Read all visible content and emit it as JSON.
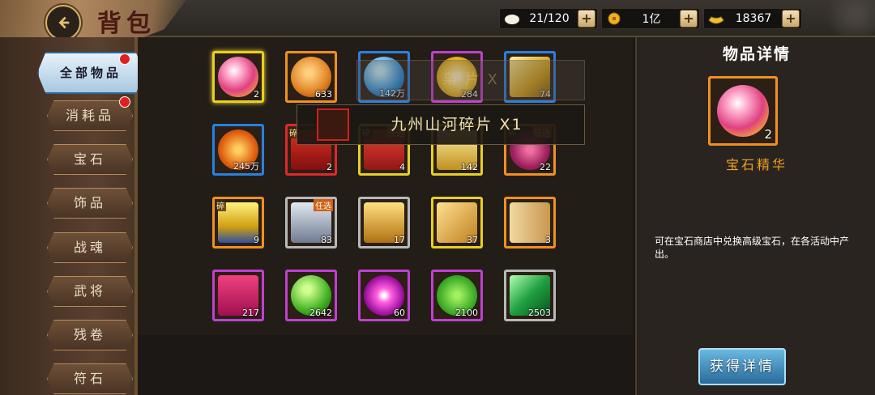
{
  "header": {
    "title": "背包",
    "resources": [
      {
        "icon": "rice-bun-icon",
        "value": "21/120"
      },
      {
        "icon": "copper-coin-icon",
        "value": "1亿"
      },
      {
        "icon": "gold-ingot-icon",
        "value": "18367"
      }
    ],
    "plus_label": "+"
  },
  "sidebar": {
    "tabs": [
      {
        "label": "全部物品",
        "active": true,
        "dot": true
      },
      {
        "label": "消耗品",
        "dot": true
      },
      {
        "label": "宝石"
      },
      {
        "label": "饰品"
      },
      {
        "label": "战魂"
      },
      {
        "label": "武将"
      },
      {
        "label": "残卷"
      },
      {
        "label": "符石"
      }
    ]
  },
  "grid": {
    "items": [
      {
        "qty": "2",
        "border": "yellow",
        "art": "pink-gem",
        "selected": true
      },
      {
        "qty": "633",
        "border": "orange",
        "art": "cracked-orb"
      },
      {
        "qty": "142万",
        "border": "blue",
        "art": "blue-egg"
      },
      {
        "qty": "284",
        "border": "purple",
        "art": "gold-coin"
      },
      {
        "qty": "74",
        "border": "blue",
        "art": "gold-plaque"
      },
      {
        "qty": "245万",
        "border": "blue",
        "art": "red-ingot"
      },
      {
        "qty": "2",
        "border": "red",
        "art": "red-chest",
        "tag": "碎"
      },
      {
        "qty": "4",
        "border": "yellow",
        "art": "red-chest-2",
        "tag": "碎",
        "tag2": "任选"
      },
      {
        "qty": "142",
        "border": "yellow",
        "art": "gold-box"
      },
      {
        "qty": "22",
        "border": "orange",
        "art": "purple-orb",
        "tag": "碎",
        "tag2": "任选"
      },
      {
        "qty": "9",
        "border": "orange",
        "art": "gold-trophy",
        "tag": "碎"
      },
      {
        "qty": "83",
        "border": "gray",
        "art": "silver-chest",
        "tag2": "任选"
      },
      {
        "qty": "17",
        "border": "gray",
        "art": "gold-chest"
      },
      {
        "qty": "37",
        "border": "yellow",
        "art": "bead-plaque"
      },
      {
        "qty": "3",
        "border": "orange",
        "art": "scroll"
      },
      {
        "qty": "217",
        "border": "purple",
        "art": "puzzle-shirt"
      },
      {
        "qty": "2642",
        "border": "purple",
        "art": "green-ball"
      },
      {
        "qty": "60",
        "border": "purple",
        "art": "magenta-orb"
      },
      {
        "qty": "2100",
        "border": "purple",
        "art": "green-paw"
      },
      {
        "qty": "2503",
        "border": "gray",
        "art": "emerald"
      }
    ],
    "ghost_text": "枭  片 X",
    "toast_text": "九州山河碎片 X1"
  },
  "detail": {
    "title": "物品详情",
    "qty": "2",
    "name": "宝石精华",
    "description": "可在宝石商店中兑换高级宝石，在各活动中产出。",
    "obtain_label": "获得详情"
  },
  "colors": {
    "yellow": "#e8d020",
    "orange": "#f09020",
    "purple": "#c040d0",
    "blue": "#2a80e0",
    "red": "#e02828",
    "gray": "#b8b8b8"
  }
}
